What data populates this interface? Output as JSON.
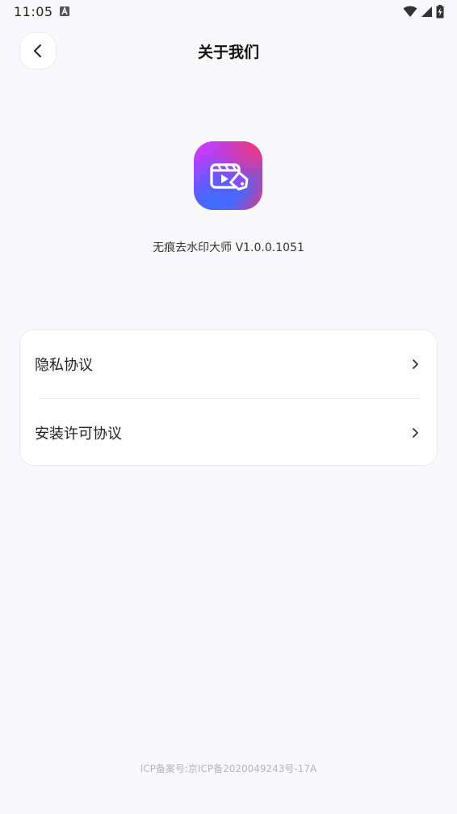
{
  "status_bar": {
    "time": "11:05"
  },
  "header": {
    "title": "关于我们"
  },
  "app": {
    "version_text": "无痕去水印大师 V1.0.0.1051"
  },
  "menu": {
    "items": [
      {
        "label": "隐私协议"
      },
      {
        "label": "安装许可协议"
      }
    ]
  },
  "footer": {
    "icp": "ICP备案号:京ICP备2020049243号-17A"
  },
  "colors": {
    "background": "#f9f9fb",
    "card": "#ffffff",
    "icon_gradient_start": "#d63af7",
    "icon_gradient_end": "#3e6dfc"
  },
  "icons": {
    "back": "chevron-left-icon",
    "menu_arrow": "chevron-right-icon",
    "app": "video-clapper-tag-icon"
  }
}
